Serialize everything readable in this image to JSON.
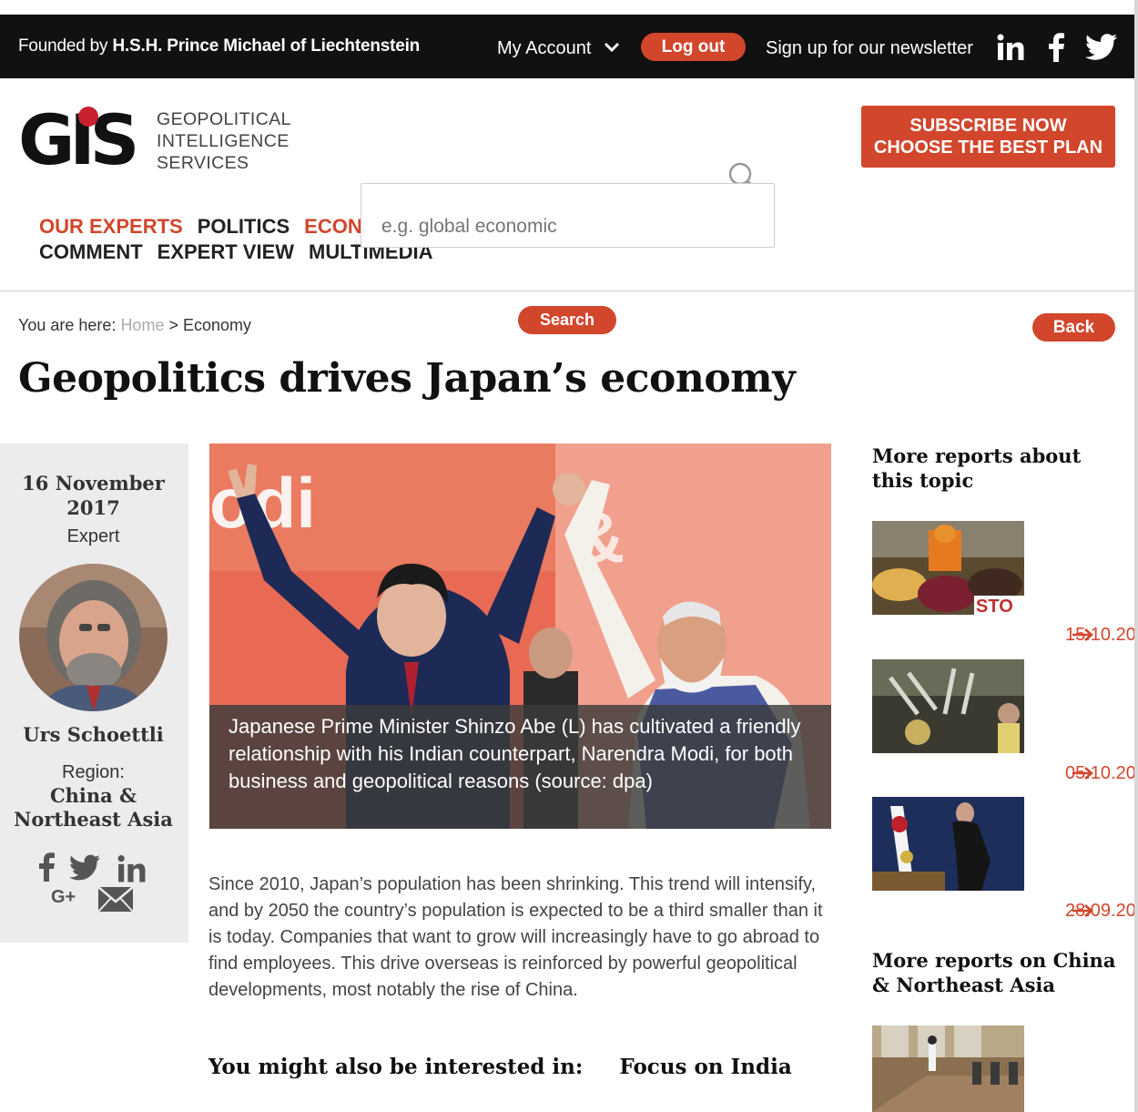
{
  "topbar": {
    "founded_prefix": "Founded by ",
    "founded_name": "H.S.H. Prince Michael of Liechtenstein",
    "my_account": "My Account",
    "logout": "Log out",
    "newsletter": "Sign up for our newsletter",
    "social_icons": [
      "linkedin-icon",
      "facebook-icon",
      "twitter-icon"
    ]
  },
  "logo": {
    "mark": "GIS",
    "line1": "GEOPOLITICAL",
    "line2": "INTELLIGENCE",
    "line3": "SERVICES"
  },
  "subscribe": {
    "line1": "SUBSCRIBE NOW",
    "line2": "CHOOSE THE BEST PLAN"
  },
  "nav": {
    "row1": [
      "OUR EXPERTS",
      "POLITICS",
      "ECON"
    ],
    "row2": [
      "COMMENT",
      "EXPERT VIEW",
      "MULTIMEDIA"
    ]
  },
  "search": {
    "placeholder": "e.g. global economic",
    "button": "Search"
  },
  "breadcrumb": {
    "prefix": "You are here:",
    "home": "Home",
    "sep": ">",
    "current": "Economy"
  },
  "back": "Back",
  "article": {
    "title": "Geopolitics drives Japan’s economy",
    "date_line1": "16 November",
    "date_line2": "2017",
    "type": "Expert",
    "author": "Urs Schoettli",
    "region_label": "Region:",
    "region_line1": "China &",
    "region_line2": "Northeast Asia",
    "share_icons": [
      "facebook-icon",
      "twitter-icon",
      "linkedin-icon",
      "google-plus-icon",
      "email-icon"
    ],
    "google_plus_text": "G+",
    "caption": "Japanese Prime Minister Shinzo Abe (L) has cultivated a friendly relationship with his Indian counterpart, Narendra Modi, for both business and geopolitical reasons (source: dpa)",
    "body": "Since 2010, Japan’s population has been shrinking. This trend will intensify, and by 2050 the country’s population is expected to be a third smaller than it is today. Companies that want to grow will increasingly have to go abroad to find employees. This drive overseas is reinforced by powerful geopolitical developments, most notably the rise of China.",
    "interested_label": "You might also be interested in:",
    "interested_link": "Focus on India",
    "hero_texts": [
      "odi",
      "&"
    ]
  },
  "sidebar": {
    "more_topic_heading": "More reports about this topic",
    "reports": [
      {
        "date": "15.10.20"
      },
      {
        "date": "05.10.20"
      },
      {
        "date": "28.09.20"
      }
    ],
    "more_region_heading": "More reports on China & Northeast Asia",
    "thumb1_sign": "STO"
  },
  "colors": {
    "accent": "#d2462c",
    "topbar": "#111111",
    "panel": "#ececec"
  }
}
